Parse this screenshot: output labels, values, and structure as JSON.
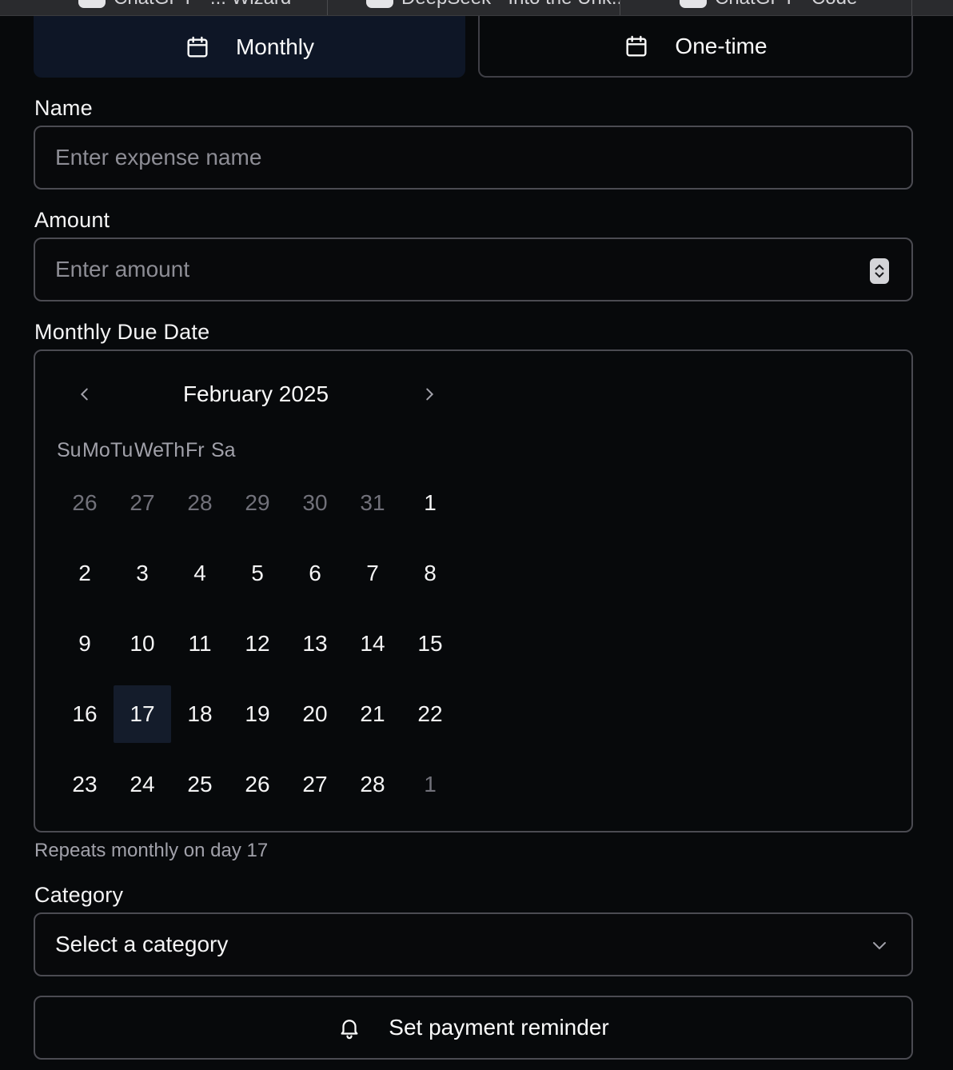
{
  "tabs": [
    {
      "label": "ChatGPT - ... Wizard",
      "icon": "openai-icon"
    },
    {
      "label": "DeepSeek - Into the Unk...",
      "icon": "deepseek-icon"
    },
    {
      "label": "ChatGPT - Code",
      "icon": "openai-icon"
    }
  ],
  "mode": {
    "monthly_label": "Monthly",
    "onetime_label": "One-time",
    "selected": "Monthly"
  },
  "name": {
    "label": "Name",
    "placeholder": "Enter expense name",
    "value": ""
  },
  "amount": {
    "label": "Amount",
    "placeholder": "Enter amount",
    "value": ""
  },
  "due_date": {
    "label": "Monthly Due Date",
    "month_title": "February 2025",
    "weekdays": [
      "Su",
      "Mo",
      "Tu",
      "We",
      "Th",
      "Fr",
      "Sa"
    ],
    "weeks": [
      [
        {
          "d": "26",
          "out": true
        },
        {
          "d": "27",
          "out": true
        },
        {
          "d": "28",
          "out": true
        },
        {
          "d": "29",
          "out": true
        },
        {
          "d": "30",
          "out": true
        },
        {
          "d": "31",
          "out": true
        },
        {
          "d": "1",
          "out": false
        }
      ],
      [
        {
          "d": "2",
          "out": false
        },
        {
          "d": "3",
          "out": false
        },
        {
          "d": "4",
          "out": false
        },
        {
          "d": "5",
          "out": false
        },
        {
          "d": "6",
          "out": false
        },
        {
          "d": "7",
          "out": false
        },
        {
          "d": "8",
          "out": false
        }
      ],
      [
        {
          "d": "9",
          "out": false
        },
        {
          "d": "10",
          "out": false
        },
        {
          "d": "11",
          "out": false
        },
        {
          "d": "12",
          "out": false
        },
        {
          "d": "13",
          "out": false
        },
        {
          "d": "14",
          "out": false
        },
        {
          "d": "15",
          "out": false
        }
      ],
      [
        {
          "d": "16",
          "out": false
        },
        {
          "d": "17",
          "out": false,
          "selected": true
        },
        {
          "d": "18",
          "out": false
        },
        {
          "d": "19",
          "out": false
        },
        {
          "d": "20",
          "out": false
        },
        {
          "d": "21",
          "out": false
        },
        {
          "d": "22",
          "out": false
        }
      ],
      [
        {
          "d": "23",
          "out": false
        },
        {
          "d": "24",
          "out": false
        },
        {
          "d": "25",
          "out": false
        },
        {
          "d": "26",
          "out": false
        },
        {
          "d": "27",
          "out": false
        },
        {
          "d": "28",
          "out": false
        },
        {
          "d": "1",
          "out": true
        }
      ]
    ],
    "hint": "Repeats monthly on day 17"
  },
  "category": {
    "label": "Category",
    "value": "Select a category"
  },
  "reminder": {
    "label": "Set payment reminder"
  },
  "colors": {
    "background": "#07090b",
    "selected_fill": "#0e1626",
    "border": "#4b4b52",
    "muted_text": "#a1a1aa"
  }
}
